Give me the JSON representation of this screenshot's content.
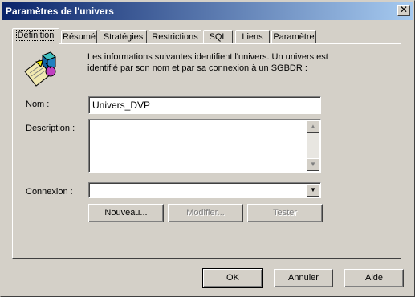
{
  "window": {
    "title": "Paramètres de l'univers",
    "close_glyph": "✕"
  },
  "tabs": [
    {
      "label": "Définition",
      "active": true
    },
    {
      "label": "Résumé"
    },
    {
      "label": "Stratégies"
    },
    {
      "label": "Restrictions"
    },
    {
      "label": "SQL"
    },
    {
      "label": "Liens"
    },
    {
      "label": "Paramètre"
    }
  ],
  "definition": {
    "intro_line1": "Les informations suivantes identifient l'univers. Un univers est",
    "intro_line2": "identifié par son nom et par sa connexion à un SGBDR :",
    "name_label": "Nom :",
    "name_value": "Univers_DVP",
    "description_label": "Description :",
    "description_value": "",
    "connection_label": "Connexion :",
    "connection_value": "",
    "new_button": "Nouveau...",
    "modify_button": "Modifier...",
    "test_button": "Tester"
  },
  "footer": {
    "ok": "OK",
    "cancel": "Annuler",
    "help": "Aide"
  },
  "icons": {
    "universe": "universe-icon",
    "close": "close-icon"
  }
}
